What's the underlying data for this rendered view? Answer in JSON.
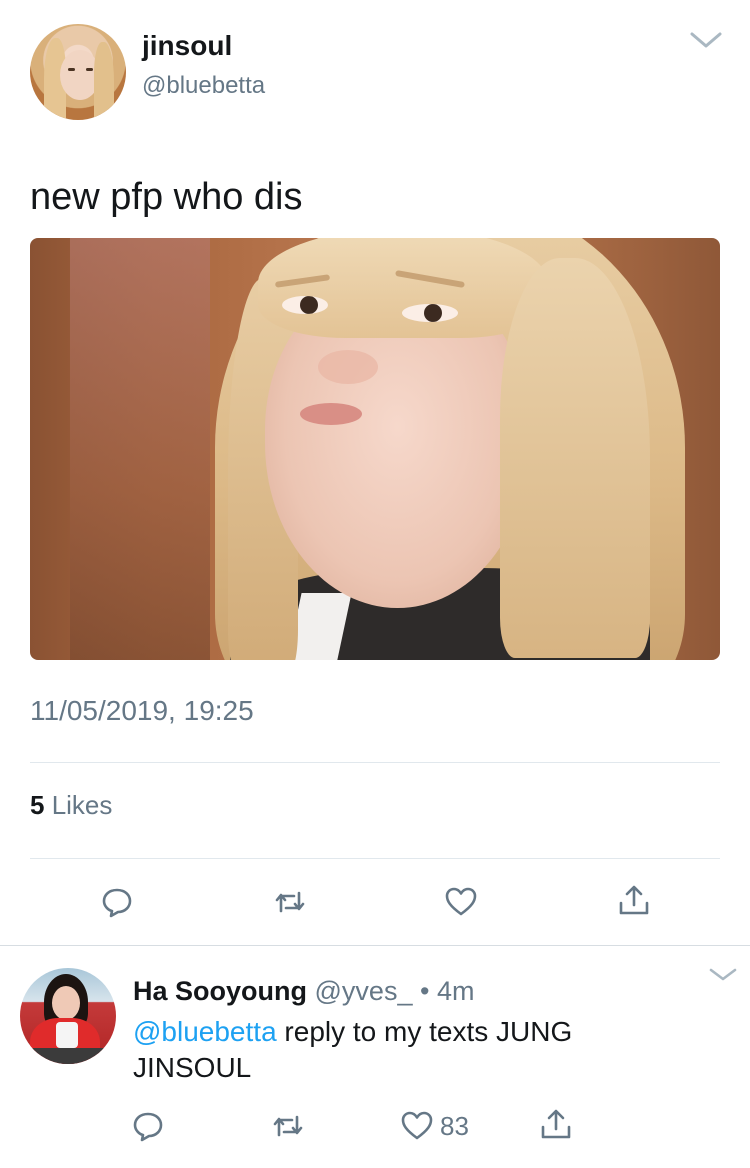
{
  "tweet": {
    "author": {
      "display_name": "jinsoul",
      "handle": "@bluebetta"
    },
    "text": "new pfp who dis",
    "timestamp": "11/05/2019, 19:25",
    "likes_count": "5",
    "likes_label": " Likes"
  },
  "reply": {
    "author": {
      "display_name": "Ha Sooyoung",
      "handle": "@yves_",
      "time": "4m"
    },
    "separator": " • ",
    "mention": "@bluebetta",
    "text": " reply to my texts JUNG JINSOUL",
    "like_count": "83"
  },
  "icons": {
    "tweet_actions": [
      "reply-icon",
      "retweet-icon",
      "like-icon",
      "share-icon"
    ],
    "reply_actions": [
      "reply-icon",
      "retweet-icon",
      "like-icon",
      "share-icon"
    ],
    "menu": "chevron-down-icon"
  },
  "colors": {
    "text_primary": "#14171a",
    "text_secondary": "#657786",
    "link": "#1da1f2",
    "divider": "#e1e8ed"
  }
}
